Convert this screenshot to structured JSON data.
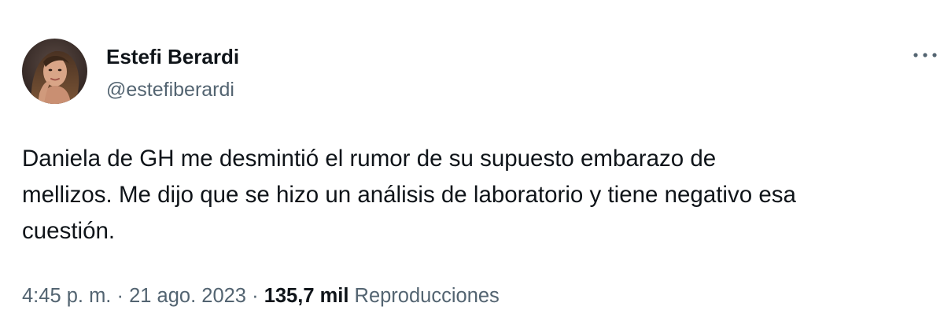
{
  "author": {
    "display_name": "Estefi Berardi",
    "handle": "@estefiberardi",
    "avatar_icon": "profile-photo"
  },
  "menu": {
    "icon": "more-options-icon"
  },
  "tweet": {
    "lines": [
      "Daniela de GH me desmintió el rumor de su supuesto embarazo de",
      "mellizos. Me dijo que se hizo un análisis de laboratorio y tiene negativo esa",
      "cuestión."
    ]
  },
  "meta": {
    "time": "4:45 p. m.",
    "separator": "·",
    "date": "21 ago. 2023",
    "views_count": "135,7 mil",
    "views_label": "Reproducciones"
  },
  "colors": {
    "primary_text": "#0f1419",
    "secondary_text": "#536471",
    "background": "#ffffff"
  }
}
